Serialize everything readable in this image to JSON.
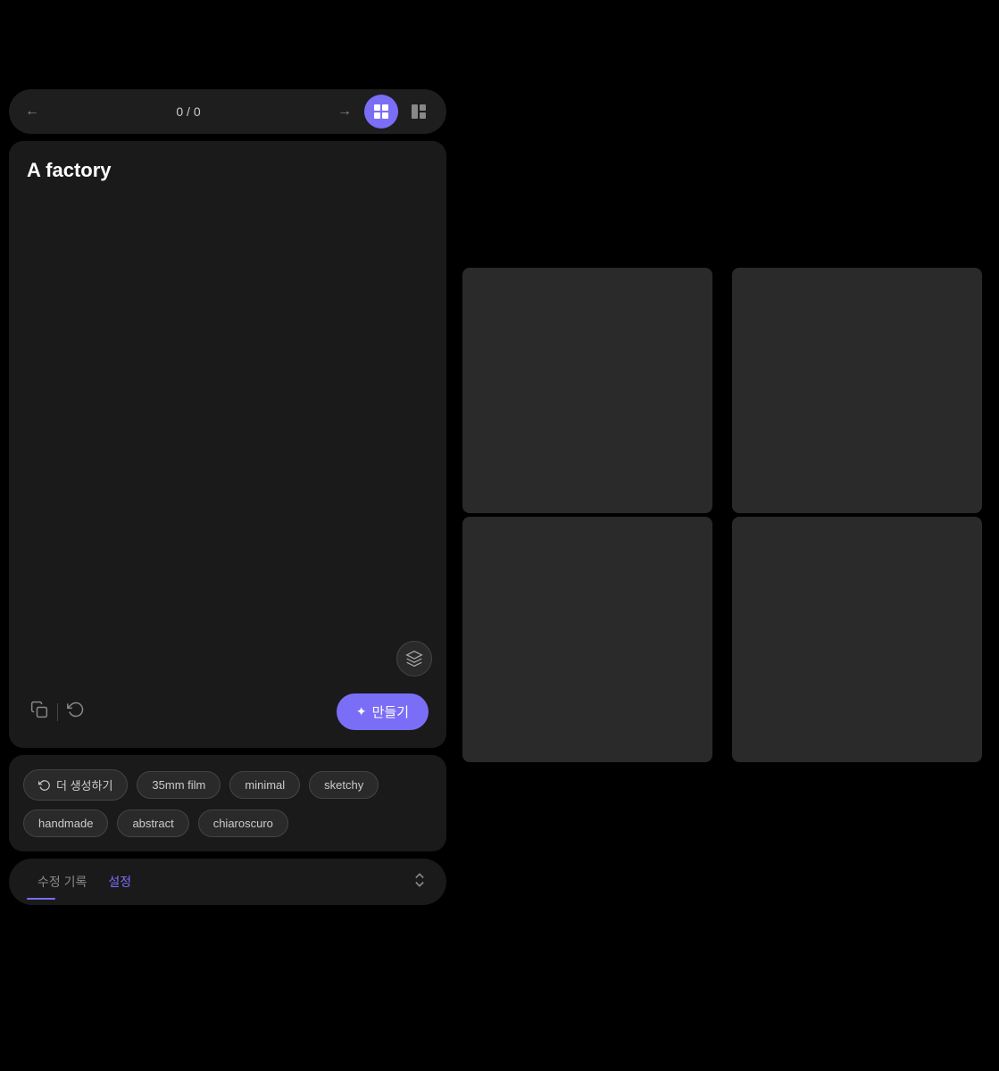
{
  "nav": {
    "prev_label": "←",
    "next_label": "→",
    "counter": "0 / 0",
    "grid_view_active": true,
    "split_view_active": false
  },
  "prompt_card": {
    "title": "A factory",
    "ar_button_label": "⬡"
  },
  "toolbar": {
    "copy_icon": "⧉",
    "refresh_icon": "↺",
    "create_label": "만들기",
    "sparkle": "✦"
  },
  "chips": [
    {
      "id": "regenerate",
      "label": "더 생성하기",
      "icon": "↺",
      "is_action": true
    },
    {
      "id": "35mm",
      "label": "35mm film",
      "is_action": false
    },
    {
      "id": "minimal",
      "label": "minimal",
      "is_action": false
    },
    {
      "id": "sketchy",
      "label": "sketchy",
      "is_action": false
    },
    {
      "id": "handmade",
      "label": "handmade",
      "is_action": false
    },
    {
      "id": "abstract",
      "label": "abstract",
      "is_action": false
    },
    {
      "id": "chiaroscuro",
      "label": "chiaroscuro",
      "is_action": false
    }
  ],
  "tabs": [
    {
      "id": "history",
      "label": "수정 기록",
      "active": false
    },
    {
      "id": "settings",
      "label": "설정",
      "active": true
    }
  ],
  "grid": {
    "cells": [
      {
        "id": "cell-1"
      },
      {
        "id": "cell-2"
      },
      {
        "id": "cell-3"
      },
      {
        "id": "cell-4"
      }
    ]
  },
  "colors": {
    "accent": "#7b6ef6",
    "bg_dark": "#000000",
    "panel_bg": "#1a1a1a",
    "chip_bg": "#2a2a2a",
    "grid_cell_bg": "#2a2a2a"
  }
}
